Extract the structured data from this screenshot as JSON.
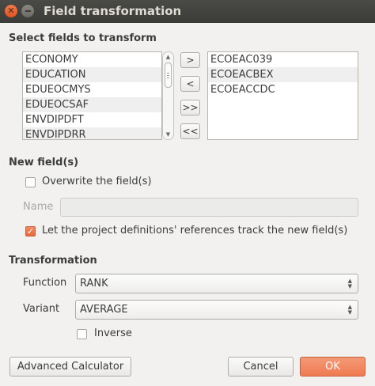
{
  "window": {
    "title": "Field transformation"
  },
  "select_fields": {
    "heading": "Select fields to transform",
    "available": [
      "ECONOMY",
      "EDUCATION",
      "EDUEOCMYS",
      "EDUEOCSAF",
      "ENVDIPDFT",
      "ENVDIPDRR"
    ],
    "selected": [
      "ECOEAC039",
      "ECOEACBEX",
      "ECOEACCDC"
    ],
    "buttons": {
      "add": ">",
      "remove": "<",
      "add_all": ">>",
      "remove_all": "<<"
    }
  },
  "new_fields": {
    "heading": "New field(s)",
    "overwrite_label": "Overwrite the field(s)",
    "overwrite_checked": false,
    "name_label": "Name",
    "name_value": "",
    "track_label": "Let the project definitions' references track the new field(s)",
    "track_checked": true
  },
  "transformation": {
    "heading": "Transformation",
    "function_label": "Function",
    "function_value": "RANK",
    "variant_label": "Variant",
    "variant_value": "AVERAGE",
    "inverse_label": "Inverse",
    "inverse_checked": false
  },
  "footer": {
    "advanced_calculator": "Advanced Calculator",
    "cancel": "Cancel",
    "ok": "OK"
  },
  "colors": {
    "accent": "#ef7b51",
    "titlebar": "#3b3b38",
    "background": "#f2f1f0"
  },
  "icons": {
    "close": "close-icon",
    "minimize": "minimize-icon",
    "spin": "spin-arrows-icon"
  }
}
